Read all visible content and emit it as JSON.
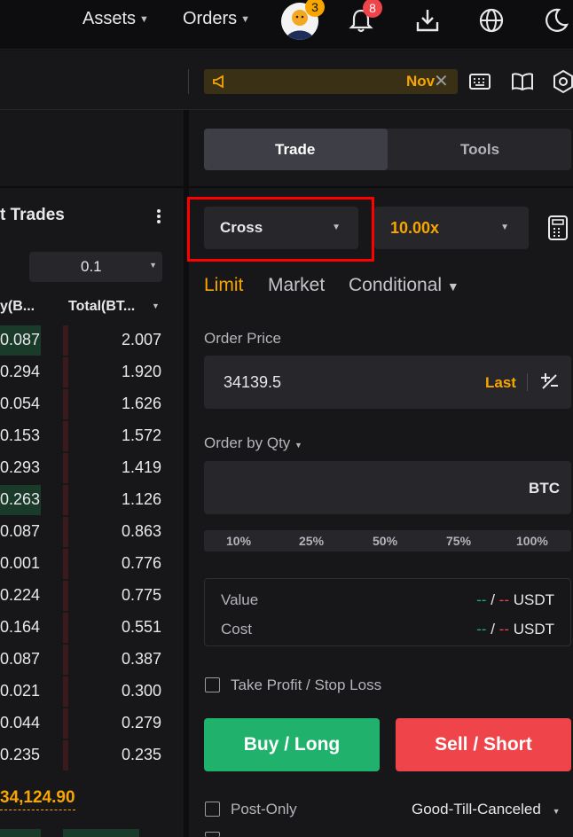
{
  "nav": {
    "assets_label": "Assets",
    "orders_label": "Orders",
    "avatar_badge": "3",
    "notifications_badge": "8",
    "icons": [
      "download-icon",
      "globe-icon",
      "moon-icon"
    ]
  },
  "subbar": {
    "notice_text": "Nov"
  },
  "orderbook": {
    "title": "t Trades",
    "precision": "0.1",
    "col_qty_header": "y(B...",
    "col_total_header": "Total(BT...",
    "rows": [
      {
        "qty": "0.087",
        "total": "2.007",
        "hl": true
      },
      {
        "qty": "0.294",
        "total": "1.920",
        "hl": false
      },
      {
        "qty": "0.054",
        "total": "1.626",
        "hl": false
      },
      {
        "qty": "0.153",
        "total": "1.572",
        "hl": false
      },
      {
        "qty": "0.293",
        "total": "1.419",
        "hl": false
      },
      {
        "qty": "0.263",
        "total": "1.126",
        "hl": true
      },
      {
        "qty": "0.087",
        "total": "0.863",
        "hl": false
      },
      {
        "qty": "0.001",
        "total": "0.776",
        "hl": false
      },
      {
        "qty": "0.224",
        "total": "0.775",
        "hl": false
      },
      {
        "qty": "0.164",
        "total": "0.551",
        "hl": false
      },
      {
        "qty": "0.087",
        "total": "0.387",
        "hl": false
      },
      {
        "qty": "0.021",
        "total": "0.300",
        "hl": false
      },
      {
        "qty": "0.044",
        "total": "0.279",
        "hl": false
      },
      {
        "qty": "0.235",
        "total": "0.235",
        "hl": false
      }
    ],
    "last_price": "34,124.90"
  },
  "trade": {
    "tab_trade": "Trade",
    "tab_tools": "Tools",
    "margin_mode": "Cross",
    "leverage": "10.00x",
    "order_types": [
      "Limit",
      "Market",
      "Conditional"
    ],
    "order_price_label": "Order Price",
    "order_price_value": "34139.5",
    "last_button": "Last",
    "qty_label": "Order by Qty",
    "qty_unit": "BTC",
    "percents": [
      "10%",
      "25%",
      "50%",
      "75%",
      "100%"
    ],
    "value_label": "Value",
    "cost_label": "Cost",
    "dash_green": "--",
    "slash": "/",
    "dash_red": "--",
    "currency": "USDT",
    "tpsl_label": "Take Profit / Stop Loss",
    "buy_label": "Buy / Long",
    "sell_label": "Sell / Short",
    "post_only_label": "Post-Only",
    "tif_value": "Good-Till-Canceled"
  },
  "colors": {
    "accent": "#f7a600",
    "buy": "#20b26c",
    "sell": "#ef454a",
    "highlight_box": "#ff0000"
  }
}
